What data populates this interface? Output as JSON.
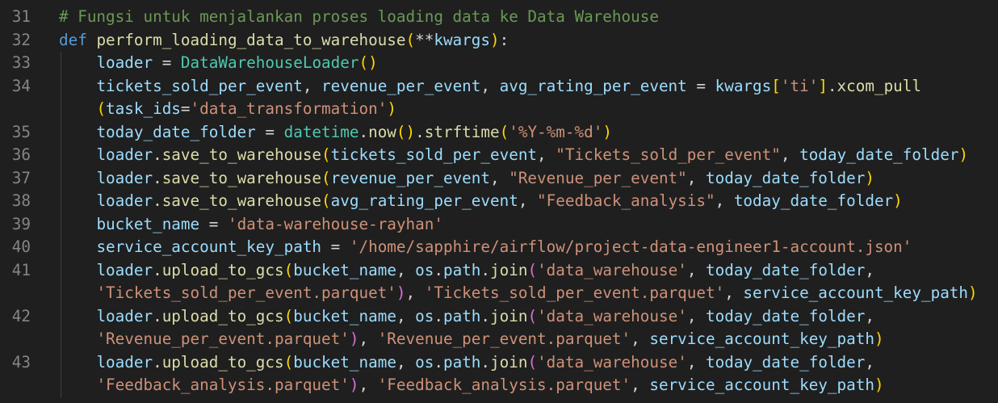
{
  "lines": [
    {
      "number": "31",
      "tokens": [
        {
          "t": "# Fungsi untuk menjalankan proses loading data ke Data Warehouse",
          "c": "cm"
        }
      ]
    },
    {
      "number": "32",
      "tokens": [
        {
          "t": "def",
          "c": "kw"
        },
        {
          "t": " ",
          "c": "op"
        },
        {
          "t": "perform_loading_data_to_warehouse",
          "c": "fn"
        },
        {
          "t": "(",
          "c": "b1"
        },
        {
          "t": "**",
          "c": "op"
        },
        {
          "t": "kwargs",
          "c": "var"
        },
        {
          "t": ")",
          "c": "b1"
        },
        {
          "t": ":",
          "c": "op"
        }
      ]
    },
    {
      "number": "33",
      "tokens": [
        {
          "t": "    ",
          "c": "op"
        },
        {
          "t": "loader",
          "c": "var"
        },
        {
          "t": " = ",
          "c": "op"
        },
        {
          "t": "DataWarehouseLoader",
          "c": "cls"
        },
        {
          "t": "()",
          "c": "b1"
        }
      ]
    },
    {
      "number": "34",
      "tokens": [
        {
          "t": "    ",
          "c": "op"
        },
        {
          "t": "tickets_sold_per_event",
          "c": "var"
        },
        {
          "t": ", ",
          "c": "op"
        },
        {
          "t": "revenue_per_event",
          "c": "var"
        },
        {
          "t": ", ",
          "c": "op"
        },
        {
          "t": "avg_rating_per_event",
          "c": "var"
        },
        {
          "t": " = ",
          "c": "op"
        },
        {
          "t": "kwargs",
          "c": "var"
        },
        {
          "t": "[",
          "c": "b1"
        },
        {
          "t": "'ti'",
          "c": "str"
        },
        {
          "t": "]",
          "c": "b1"
        },
        {
          "t": ".",
          "c": "op"
        },
        {
          "t": "xcom_pull",
          "c": "fn"
        }
      ]
    },
    {
      "number": "",
      "tokens": [
        {
          "t": "    ",
          "c": "op"
        },
        {
          "t": "(",
          "c": "b1"
        },
        {
          "t": "task_ids",
          "c": "var"
        },
        {
          "t": "=",
          "c": "op"
        },
        {
          "t": "'data_transformation'",
          "c": "str"
        },
        {
          "t": ")",
          "c": "b1"
        }
      ]
    },
    {
      "number": "35",
      "tokens": [
        {
          "t": "    ",
          "c": "op"
        },
        {
          "t": "today_date_folder",
          "c": "var"
        },
        {
          "t": " = ",
          "c": "op"
        },
        {
          "t": "datetime",
          "c": "cls"
        },
        {
          "t": ".",
          "c": "op"
        },
        {
          "t": "now",
          "c": "fn"
        },
        {
          "t": "()",
          "c": "b1"
        },
        {
          "t": ".",
          "c": "op"
        },
        {
          "t": "strftime",
          "c": "fn"
        },
        {
          "t": "(",
          "c": "b1"
        },
        {
          "t": "'%Y-%m-%d'",
          "c": "str"
        },
        {
          "t": ")",
          "c": "b1"
        }
      ]
    },
    {
      "number": "36",
      "tokens": [
        {
          "t": "    ",
          "c": "op"
        },
        {
          "t": "loader",
          "c": "var"
        },
        {
          "t": ".",
          "c": "op"
        },
        {
          "t": "save_to_warehouse",
          "c": "fn"
        },
        {
          "t": "(",
          "c": "b1"
        },
        {
          "t": "tickets_sold_per_event",
          "c": "var"
        },
        {
          "t": ", ",
          "c": "op"
        },
        {
          "t": "\"Tickets_sold_per_event\"",
          "c": "str"
        },
        {
          "t": ", ",
          "c": "op"
        },
        {
          "t": "today_date_folder",
          "c": "var"
        },
        {
          "t": ")",
          "c": "b1"
        }
      ]
    },
    {
      "number": "37",
      "tokens": [
        {
          "t": "    ",
          "c": "op"
        },
        {
          "t": "loader",
          "c": "var"
        },
        {
          "t": ".",
          "c": "op"
        },
        {
          "t": "save_to_warehouse",
          "c": "fn"
        },
        {
          "t": "(",
          "c": "b1"
        },
        {
          "t": "revenue_per_event",
          "c": "var"
        },
        {
          "t": ", ",
          "c": "op"
        },
        {
          "t": "\"Revenue_per_event\"",
          "c": "str"
        },
        {
          "t": ", ",
          "c": "op"
        },
        {
          "t": "today_date_folder",
          "c": "var"
        },
        {
          "t": ")",
          "c": "b1"
        }
      ]
    },
    {
      "number": "38",
      "tokens": [
        {
          "t": "    ",
          "c": "op"
        },
        {
          "t": "loader",
          "c": "var"
        },
        {
          "t": ".",
          "c": "op"
        },
        {
          "t": "save_to_warehouse",
          "c": "fn"
        },
        {
          "t": "(",
          "c": "b1"
        },
        {
          "t": "avg_rating_per_event",
          "c": "var"
        },
        {
          "t": ", ",
          "c": "op"
        },
        {
          "t": "\"Feedback_analysis\"",
          "c": "str"
        },
        {
          "t": ", ",
          "c": "op"
        },
        {
          "t": "today_date_folder",
          "c": "var"
        },
        {
          "t": ")",
          "c": "b1"
        }
      ]
    },
    {
      "number": "39",
      "tokens": [
        {
          "t": "    ",
          "c": "op"
        },
        {
          "t": "bucket_name",
          "c": "var"
        },
        {
          "t": " = ",
          "c": "op"
        },
        {
          "t": "'data-warehouse-rayhan'",
          "c": "str"
        }
      ]
    },
    {
      "number": "40",
      "tokens": [
        {
          "t": "    ",
          "c": "op"
        },
        {
          "t": "service_account_key_path",
          "c": "var"
        },
        {
          "t": " = ",
          "c": "op"
        },
        {
          "t": "'/home/sapphire/airflow/project-data-engineer1-account.json'",
          "c": "str"
        }
      ]
    },
    {
      "number": "41",
      "tokens": [
        {
          "t": "    ",
          "c": "op"
        },
        {
          "t": "loader",
          "c": "var"
        },
        {
          "t": ".",
          "c": "op"
        },
        {
          "t": "upload_to_gcs",
          "c": "fn"
        },
        {
          "t": "(",
          "c": "b1"
        },
        {
          "t": "bucket_name",
          "c": "var"
        },
        {
          "t": ", ",
          "c": "op"
        },
        {
          "t": "os",
          "c": "var"
        },
        {
          "t": ".",
          "c": "op"
        },
        {
          "t": "path",
          "c": "var"
        },
        {
          "t": ".",
          "c": "op"
        },
        {
          "t": "join",
          "c": "fn"
        },
        {
          "t": "(",
          "c": "b2"
        },
        {
          "t": "'data_warehouse'",
          "c": "str"
        },
        {
          "t": ", ",
          "c": "op"
        },
        {
          "t": "today_date_folder",
          "c": "var"
        },
        {
          "t": ",",
          "c": "op"
        }
      ]
    },
    {
      "number": "",
      "tokens": [
        {
          "t": "    ",
          "c": "op"
        },
        {
          "t": "'Tickets_sold_per_event.parquet'",
          "c": "str"
        },
        {
          "t": ")",
          "c": "b2"
        },
        {
          "t": ", ",
          "c": "op"
        },
        {
          "t": "'Tickets_sold_per_event.parquet'",
          "c": "str"
        },
        {
          "t": ", ",
          "c": "op"
        },
        {
          "t": "service_account_key_path",
          "c": "var"
        },
        {
          "t": ")",
          "c": "b1"
        }
      ]
    },
    {
      "number": "42",
      "tokens": [
        {
          "t": "    ",
          "c": "op"
        },
        {
          "t": "loader",
          "c": "var"
        },
        {
          "t": ".",
          "c": "op"
        },
        {
          "t": "upload_to_gcs",
          "c": "fn"
        },
        {
          "t": "(",
          "c": "b1"
        },
        {
          "t": "bucket_name",
          "c": "var"
        },
        {
          "t": ", ",
          "c": "op"
        },
        {
          "t": "os",
          "c": "var"
        },
        {
          "t": ".",
          "c": "op"
        },
        {
          "t": "path",
          "c": "var"
        },
        {
          "t": ".",
          "c": "op"
        },
        {
          "t": "join",
          "c": "fn"
        },
        {
          "t": "(",
          "c": "b2"
        },
        {
          "t": "'data_warehouse'",
          "c": "str"
        },
        {
          "t": ", ",
          "c": "op"
        },
        {
          "t": "today_date_folder",
          "c": "var"
        },
        {
          "t": ",",
          "c": "op"
        }
      ]
    },
    {
      "number": "",
      "tokens": [
        {
          "t": "    ",
          "c": "op"
        },
        {
          "t": "'Revenue_per_event.parquet'",
          "c": "str"
        },
        {
          "t": ")",
          "c": "b2"
        },
        {
          "t": ", ",
          "c": "op"
        },
        {
          "t": "'Revenue_per_event.parquet'",
          "c": "str"
        },
        {
          "t": ", ",
          "c": "op"
        },
        {
          "t": "service_account_key_path",
          "c": "var"
        },
        {
          "t": ")",
          "c": "b1"
        }
      ]
    },
    {
      "number": "43",
      "tokens": [
        {
          "t": "    ",
          "c": "op"
        },
        {
          "t": "loader",
          "c": "var"
        },
        {
          "t": ".",
          "c": "op"
        },
        {
          "t": "upload_to_gcs",
          "c": "fn"
        },
        {
          "t": "(",
          "c": "b1"
        },
        {
          "t": "bucket_name",
          "c": "var"
        },
        {
          "t": ", ",
          "c": "op"
        },
        {
          "t": "os",
          "c": "var"
        },
        {
          "t": ".",
          "c": "op"
        },
        {
          "t": "path",
          "c": "var"
        },
        {
          "t": ".",
          "c": "op"
        },
        {
          "t": "join",
          "c": "fn"
        },
        {
          "t": "(",
          "c": "b2"
        },
        {
          "t": "'data_warehouse'",
          "c": "str"
        },
        {
          "t": ", ",
          "c": "op"
        },
        {
          "t": "today_date_folder",
          "c": "var"
        },
        {
          "t": ",",
          "c": "op"
        }
      ]
    },
    {
      "number": "",
      "tokens": [
        {
          "t": "    ",
          "c": "op"
        },
        {
          "t": "'Feedback_analysis.parquet'",
          "c": "str"
        },
        {
          "t": ")",
          "c": "b2"
        },
        {
          "t": ", ",
          "c": "op"
        },
        {
          "t": "'Feedback_analysis.parquet'",
          "c": "str"
        },
        {
          "t": ", ",
          "c": "op"
        },
        {
          "t": "service_account_key_path",
          "c": "var"
        },
        {
          "t": ")",
          "c": "b1"
        }
      ]
    }
  ]
}
